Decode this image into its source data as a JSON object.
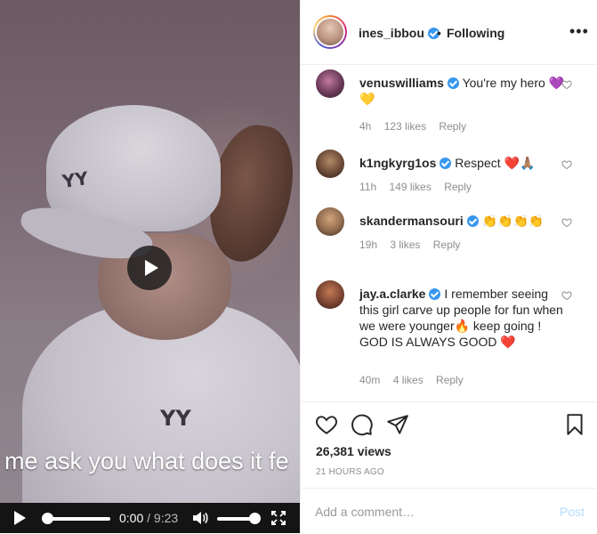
{
  "video": {
    "subtitle": "me ask you what does it fe",
    "current_time": "0:00",
    "separator": "/",
    "duration": "9:23",
    "progress": 0.0,
    "volume": 0.8,
    "logo_mark": "YY"
  },
  "header": {
    "username": "ines_ibbou",
    "dot": "•",
    "following_label": "Following",
    "more": "•••"
  },
  "comments": [
    {
      "user": "venuswilliams",
      "verified": true,
      "text": "You're my hero 💜💛",
      "age": "4h",
      "likes": "123 likes",
      "reply": "Reply"
    },
    {
      "user": "k1ngkyrg1os",
      "verified": true,
      "text": "Respect ❤️🙏🏽",
      "age": "11h",
      "likes": "149 likes",
      "reply": "Reply"
    },
    {
      "user": "skandermansouri",
      "verified": true,
      "text": "👏👏👏👏",
      "age": "19h",
      "likes": "3 likes",
      "reply": "Reply"
    },
    {
      "user": "jay.a.clarke",
      "verified": true,
      "text": "I remember seeing this girl carve up people for fun when we were younger🔥 keep going ! GOD IS ALWAYS GOOD ❤️",
      "age": "40m",
      "likes": "4 likes",
      "reply": "Reply"
    }
  ],
  "post": {
    "views": "26,381 views",
    "time_ago": "21 HOURS AGO"
  },
  "add_comment": {
    "placeholder": "Add a comment…",
    "post_label": "Post"
  },
  "colors": {
    "link_blue": "#3897f0",
    "post_disabled": "#b3dbff",
    "meta_gray": "#8e8e8e"
  }
}
